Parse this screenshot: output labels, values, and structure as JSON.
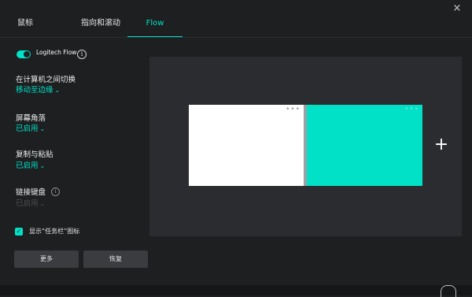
{
  "window": {
    "close_label": "×"
  },
  "tabs": [
    {
      "label": "鼠标",
      "active": false
    },
    {
      "label": "指向和滚动",
      "active": false
    },
    {
      "label": "Flow",
      "active": true
    }
  ],
  "flow_toggle": {
    "label": "Logitech Flow",
    "enabled": true
  },
  "settings": [
    {
      "title": "在计算机之间切换",
      "value": "移动至边缘",
      "chevron": "⌄",
      "enabled": true
    },
    {
      "title": "屏幕角落",
      "value": "已启用",
      "chevron": "⌄",
      "enabled": true
    },
    {
      "title": "复制与粘贴",
      "value": "已启用",
      "chevron": "⌄",
      "enabled": true
    },
    {
      "title": "链接键盘",
      "value": "已启用",
      "chevron": "⌄",
      "enabled": false
    }
  ],
  "taskbar_option": {
    "label": "显示“任务栏”图标",
    "checked": true
  },
  "buttons": {
    "more": "更多",
    "restore": "恢复"
  },
  "screens": [
    {
      "color": "#ffffff",
      "more_label": "•••"
    },
    {
      "color": "#00e1c8",
      "more_label": "•••"
    }
  ],
  "add_computer_label": "+",
  "bottom_bar": {
    "text": ""
  },
  "colors": {
    "accent": "#00e1c8",
    "background": "#1d1f21",
    "canvas": "#2a2c2f"
  }
}
